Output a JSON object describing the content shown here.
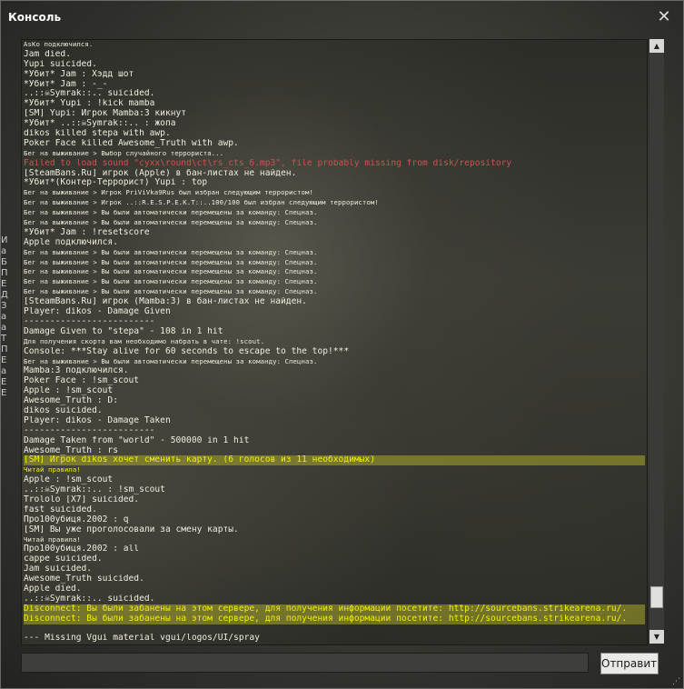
{
  "window": {
    "title": "Консоль",
    "close_icon": "close-icon"
  },
  "left_strip": [
    "И",
    "а",
    "Б",
    "П",
    "Е",
    "Д",
    "З",
    "а",
    "а",
    "Т",
    "П",
    "Е",
    "а",
    "Е",
    "Е"
  ],
  "log": [
    {
      "text": "AsKo подключился.",
      "style": "small"
    },
    {
      "text": "Jam died.",
      "style": ""
    },
    {
      "text": "Yupi suicided.",
      "style": ""
    },
    {
      "text": "*Убит* Jam :  Хэдд шот",
      "style": ""
    },
    {
      "text": "*Убит* Jam :  -_-",
      "style": ""
    },
    {
      "text": "..::☠Symrak::.. suicided.",
      "style": ""
    },
    {
      "text": "*Убит* Yupi :  !kick mamba",
      "style": ""
    },
    {
      "text": "[SM] Yupi: Игрок Mamba:3 кикнут",
      "style": ""
    },
    {
      "text": "*Убит* ..::☠Symrak::.. :  жопа",
      "style": ""
    },
    {
      "text": "dikos killed stepa with awp.",
      "style": ""
    },
    {
      "text": "Poker Face killed Awesome_Truth with awp.",
      "style": ""
    },
    {
      "text": "Бег на выживание > Выбор случайного террориста...",
      "style": "small"
    },
    {
      "text": "Failed to load sound \"cyxx\\round\\ct\\rs_cts_6.mp3\", file probably missing from disk/repository",
      "style": "red"
    },
    {
      "text": "[SteamBans.Ru] игрок (Apple) в бан-листах не найден.",
      "style": ""
    },
    {
      "text": "*Убит*(Контер-Террорист) Yupi :  top",
      "style": ""
    },
    {
      "text": "Бег на выживание > Игрок PriViVka9Rus был избран следующим террористом!",
      "style": "small"
    },
    {
      "text": "Бег на выживание > Игрок ..::R.E.S.P.E.K.T::..100/100 был избран следующим террористом!",
      "style": "small"
    },
    {
      "text": "Бег на выживание > Вы были автоматически перемещены за команду: Спецназ.",
      "style": "small"
    },
    {
      "text": "Бег на выживание > Вы были автоматически перемещены за команду: Спецназ.",
      "style": "small"
    },
    {
      "text": "*Убит* Jam :  !resetscore",
      "style": ""
    },
    {
      "text": "Apple подключился.",
      "style": ""
    },
    {
      "text": "Бег на выживание > Вы были автоматически перемещены за команду: Спецназ.",
      "style": "small"
    },
    {
      "text": "Бег на выживание > Вы были автоматически перемещены за команду: Спецназ.",
      "style": "small"
    },
    {
      "text": "Бег на выживание > Вы были автоматически перемещены за команду: Спецназ.",
      "style": "small"
    },
    {
      "text": "Бег на выживание > Вы были автоматически перемещены за команду: Спецназ.",
      "style": "small"
    },
    {
      "text": "Бег на выживание > Вы были автоматически перемещены за команду: Спецназ.",
      "style": "small"
    },
    {
      "text": "[SteamBans.Ru] игрок (Mamba:3) в бан-листах не найден.",
      "style": ""
    },
    {
      "text": "Player: dikos - Damage Given",
      "style": ""
    },
    {
      "text": "-------------------------",
      "style": ""
    },
    {
      "text": "Damage Given to \"stepa\" - 108 in 1 hit",
      "style": ""
    },
    {
      "text": "Для получения скорта вам необходимо набрать в чате: !scout.",
      "style": "small"
    },
    {
      "text": "Console: ***Stay alive for 60 seconds to escape to the top!***",
      "style": ""
    },
    {
      "text": "Бег на выживание > Вы были автоматически перемещены за команду: Спецназ.",
      "style": "small"
    },
    {
      "text": "Mamba:3 подключился.",
      "style": ""
    },
    {
      "text": "Poker Face :  !sm_scout",
      "style": ""
    },
    {
      "text": "Apple :  !sm_scout",
      "style": ""
    },
    {
      "text": "Awesome_Truth :  D:",
      "style": ""
    },
    {
      "text": "dikos suicided.",
      "style": ""
    },
    {
      "text": "Player: dikos - Damage Taken",
      "style": ""
    },
    {
      "text": "-------------------------",
      "style": ""
    },
    {
      "text": "Damage Taken from \"world\" - 500000 in 1 hit",
      "style": ""
    },
    {
      "text": "Awesome_Truth :  rs",
      "style": ""
    },
    {
      "text": "[SM] Игрок dikos хочет сменить карту. (6 голосов из 11 необходимых)",
      "style": "yellow hl"
    },
    {
      "text": "Читай правила!",
      "style": "yellow small"
    },
    {
      "text": "Apple :  !sm_scout",
      "style": ""
    },
    {
      "text": "..::☠Symrak::.. :  !sm_scout",
      "style": ""
    },
    {
      "text": "Trololo [X7] suicided.",
      "style": ""
    },
    {
      "text": "fast suicided.",
      "style": ""
    },
    {
      "text": "Про100убиця.2002 :  q",
      "style": ""
    },
    {
      "text": "[SM] Вы уже проголосовали за смену карты.",
      "style": ""
    },
    {
      "text": "Читай правила!",
      "style": "small"
    },
    {
      "text": "Про100убиця.2002 :  all",
      "style": ""
    },
    {
      "text": "cappe suicided.",
      "style": ""
    },
    {
      "text": "Jam suicided.",
      "style": ""
    },
    {
      "text": "Awesome_Truth suicided.",
      "style": ""
    },
    {
      "text": "Apple died.",
      "style": ""
    },
    {
      "text": "..::☠Symrak::.. suicided.",
      "style": ""
    },
    {
      "text": "Disconnect: Вы были забанены на этом сервере, для получения информации посетите: http://sourcebans.strikearena.ru/.",
      "style": "yellow hl"
    },
    {
      "text": "Disconnect: Вы были забанены на этом сервере, для получения информации посетите: http://sourcebans.strikearena.ru/.",
      "style": "yellow hl"
    },
    {
      "text": "",
      "style": ""
    },
    {
      "text": "--- Missing Vgui material vgui/logos/UI/spray",
      "style": ""
    }
  ],
  "input": {
    "value": "",
    "placeholder": ""
  },
  "submit_label": "Отправить",
  "scroll": {
    "position": 0.96
  }
}
